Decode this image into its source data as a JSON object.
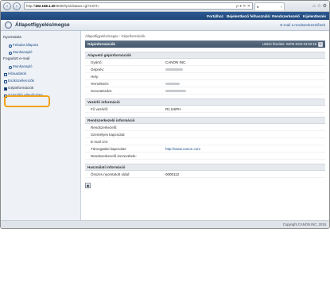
{
  "browser": {
    "url_prefix": "http://",
    "url_host": "192.168.1.20",
    "url_rest": ":8000/rps/dstatus.cgi?CSIT=",
    "tab_close": "×",
    "nav_back": "‹",
    "nav_forward": "›",
    "addr_icons": "ρ ▾ ✕ ✕",
    "window_icons": "⌂ ☆ ⚙"
  },
  "header": {
    "links": [
      "Portálhoz",
      "Bejelentkező felhasználó: Rendszerkezelő",
      "Kijelentkezés"
    ],
    "title": "Állapotfigyelés/megse",
    "send_mail": "E-mail a rendszerkezelőnek"
  },
  "sidebar": {
    "items": [
      {
        "type": "head",
        "label": "Nyomtatás"
      },
      {
        "type": "sub",
        "label": "Feladat állapota"
      },
      {
        "type": "sub",
        "label": "Munkanapló"
      },
      {
        "type": "head",
        "label": "Fogadott e-mail"
      },
      {
        "type": "sub",
        "label": "Munkanapló"
      },
      {
        "type": "item",
        "label": "Hibaadatok"
      },
      {
        "type": "item",
        "label": "Eszközellemzők"
      },
      {
        "type": "item",
        "label": "Gépinformációk",
        "active": true
      },
      {
        "type": "item",
        "label": "Számláló ellenőrzése"
      }
    ]
  },
  "main": {
    "breadcrumb": "Állapotfigyelés/megse : Gépinformációk",
    "heading": "Gépinformációk",
    "updated": "Utolsó frissítés: 04/09 2015 04:52:15",
    "refresh_icon": "↻",
    "sections": [
      {
        "title": "Alapvető gépinformációk",
        "rows": [
          {
            "k": "Gyártó:",
            "v": "CANON INC."
          },
          {
            "k": "Gépnév:",
            "v": "",
            "blur": 22
          },
          {
            "k": "Hely:",
            "v": ""
          },
          {
            "k": "Terméknév:",
            "v": "",
            "blur": 18
          },
          {
            "k": "Sorozatszám:",
            "v": "",
            "blur": 26
          }
        ]
      },
      {
        "title": "Vezérlő információ",
        "rows": [
          {
            "k": "Fő vezérlő:",
            "v": "R1.04/PH"
          }
        ]
      },
      {
        "title": "Rendszerkezelő információ",
        "rows": [
          {
            "k": "Rendszerkezelő:",
            "v": ""
          },
          {
            "k": "Személyes kapcsolat:",
            "v": ""
          },
          {
            "k": "E-mail cím:",
            "v": ""
          },
          {
            "k": "Támogatási kapcsolat:",
            "v": "http://www.canon.com",
            "link": true
          },
          {
            "k": "Rendszerkezelő észrevétele:",
            "v": ""
          }
        ]
      },
      {
        "title": "Használati információ",
        "rows": [
          {
            "k": "Összes nyomtatott oldal:",
            "v": "0000112"
          }
        ]
      }
    ],
    "print_icon": "▣"
  },
  "footer": {
    "copyright": "Copyright CANON INC. 2015"
  }
}
